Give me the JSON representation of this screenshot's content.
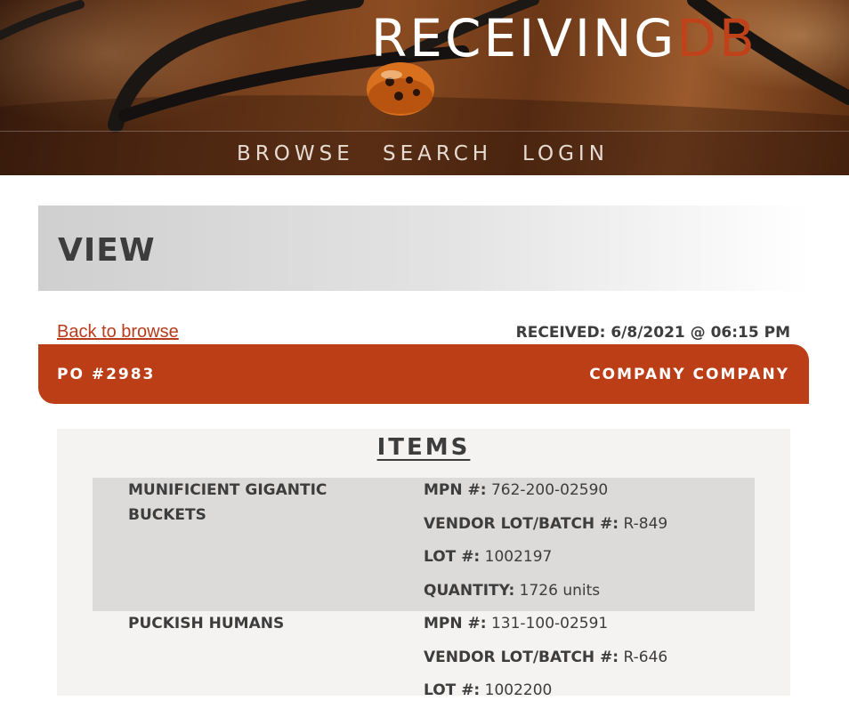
{
  "header": {
    "brand_main": "RECEIVING",
    "brand_accent": "DB",
    "nav": [
      {
        "label": "BROWSE"
      },
      {
        "label": "SEARCH"
      },
      {
        "label": "LOGIN"
      }
    ]
  },
  "page": {
    "title": "VIEW",
    "back_link": "Back to browse",
    "received": "RECEIVED: 6/8/2021 @ 06:15 PM"
  },
  "po": {
    "number": "PO #2983",
    "company": "COMPANY COMPANY"
  },
  "items": {
    "heading": "ITEMS",
    "rows": [
      {
        "name": "MUNIFICIENT GIGANTIC BUCKETS",
        "mpn_label": "MPN #:",
        "mpn": "762-200-02590",
        "vendor_lot_label": "VENDOR LOT/BATCH #:",
        "vendor_lot": "R-849",
        "lot_label": "LOT #:",
        "lot": "1002197",
        "quantity_label": "QUANTITY:",
        "quantity": "1726 units"
      },
      {
        "name": "PUCKISH HUMANS",
        "mpn_label": "MPN #:",
        "mpn": "131-100-02591",
        "vendor_lot_label": "VENDOR LOT/BATCH #:",
        "vendor_lot": "R-646",
        "lot_label": "LOT #:",
        "lot": "1002200"
      }
    ]
  },
  "colors": {
    "accent": "#bc3e17",
    "brand_accent": "#c0421a",
    "row_shade": "#dcdbda",
    "panel_bg": "#f4f3f2"
  }
}
